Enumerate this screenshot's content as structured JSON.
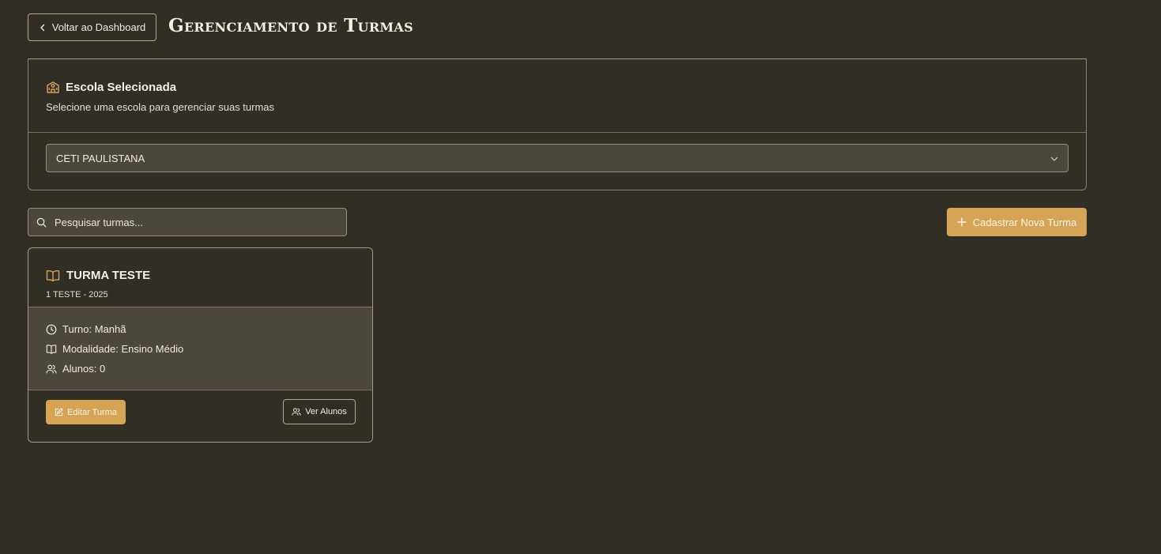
{
  "header": {
    "back_label": "Voltar ao Dashboard",
    "title": "Gerenciamento de Turmas"
  },
  "school": {
    "title": "Escola Selecionada",
    "description": "Selecione uma escola para gerenciar suas turmas",
    "selected": "CETI PAULISTANA"
  },
  "search": {
    "placeholder": "Pesquisar turmas..."
  },
  "actions": {
    "new_class_label": "Cadastrar Nova Turma"
  },
  "classes": [
    {
      "title": "TURMA TESTE",
      "subtitle": "1 TESTE - 2025",
      "shift": "Turno: Manhã",
      "modality": "Modalidade: Ensino Médio",
      "students": "Alunos: 0",
      "edit_label": "Editar Turma",
      "view_students_label": "Ver Alunos"
    }
  ],
  "colors": {
    "background": "#312e26",
    "accent": "#d6a455",
    "border": "#a99a78",
    "input_bg": "#4b473c"
  },
  "icons": [
    "chevron-left-icon",
    "school-icon",
    "chevron-down-icon",
    "search-icon",
    "plus-icon",
    "book-open-icon",
    "clock-icon",
    "users-icon",
    "edit-icon"
  ]
}
